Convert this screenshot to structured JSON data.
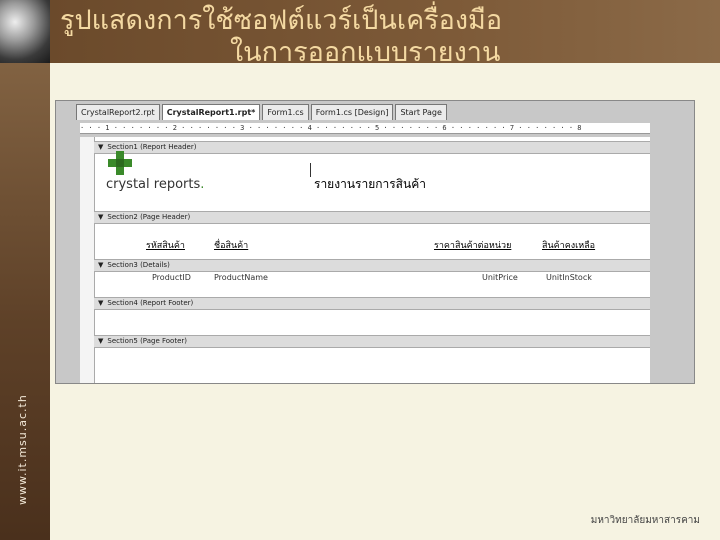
{
  "slide": {
    "title_line1": "รูปแสดงการใช้ซอฟต์แวร์เป็นเครื่องมือ",
    "title_line2": "ในการออกแบบรายงาน",
    "side_url": "www.it.msu.ac.th",
    "footer": "มหาวิทยาลัยมหาสารคาม"
  },
  "ide": {
    "tabs": [
      "CrystalReport2.rpt",
      "CrystalReport1.rpt*",
      "Form1.cs",
      "Form1.cs [Design]",
      "Start Page"
    ],
    "active_tab": 1,
    "ruler": "·  ·  ·  1  ·  ·  ·  ·  ·  ·  ·  2  ·  ·  ·  ·  ·  ·  ·  3  ·  ·  ·  ·  ·  ·  ·  4  ·  ·  ·  ·  ·  ·  ·  5  ·  ·  ·  ·  ·  ·  ·  6  ·  ·  ·  ·  ·  ·  ·  7  ·  ·  ·  ·  ·  ·  ·  8"
  },
  "sections": {
    "report_header": "Section1 (Report Header)",
    "page_header": "Section2 (Page Header)",
    "details": "Section3 (Details)",
    "report_footer": "Section4 (Report Footer)",
    "page_footer": "Section5 (Page Footer)"
  },
  "report": {
    "logo_text": "crystal reports",
    "title": "รายงานรายการสินค้า",
    "headers": [
      "รหัสสินค้า",
      "ชื่อสินค้า",
      "ราคาสินค้าต่อหน่วย",
      "สินค้าคงเหลือ"
    ],
    "fields": [
      "ProductID",
      "ProductName",
      "UnitPrice",
      "UnitInStock"
    ]
  },
  "colors": {
    "title": "#f4d9a2",
    "logo_green": "#3a8a2a"
  }
}
